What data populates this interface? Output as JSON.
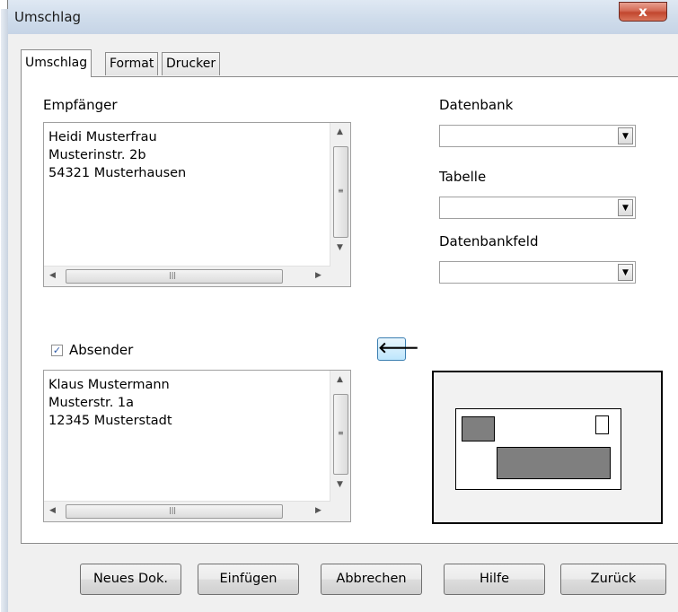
{
  "window": {
    "title": "Umschlag",
    "close_label": "x"
  },
  "tabs": [
    {
      "label": "Umschlag"
    },
    {
      "label": "Format"
    },
    {
      "label": "Drucker"
    }
  ],
  "recipient": {
    "label": "Empfänger",
    "lines": [
      "Heidi Musterfrau",
      "Musterinstr. 2b",
      "54321 Musterhausen"
    ]
  },
  "database": {
    "datenbank_label": "Datenbank",
    "datenbank_value": "",
    "tabelle_label": "Tabelle",
    "tabelle_value": "",
    "feld_label": "Datenbankfeld",
    "feld_value": ""
  },
  "insert_arrow_icon": "left-arrow-icon",
  "sender": {
    "label": "Absender",
    "checked": true,
    "lines": [
      "Klaus Mustermann",
      "Musterstr. 1a",
      "12345 Musterstadt"
    ]
  },
  "buttons": {
    "new_doc": "Neues Dok.",
    "insert": "Einfügen",
    "cancel": "Abbrechen",
    "help": "Hilfe",
    "back": "Zurück"
  },
  "colors": {
    "preview_block": "#7f7f7f",
    "close_button": "#c2462e"
  }
}
